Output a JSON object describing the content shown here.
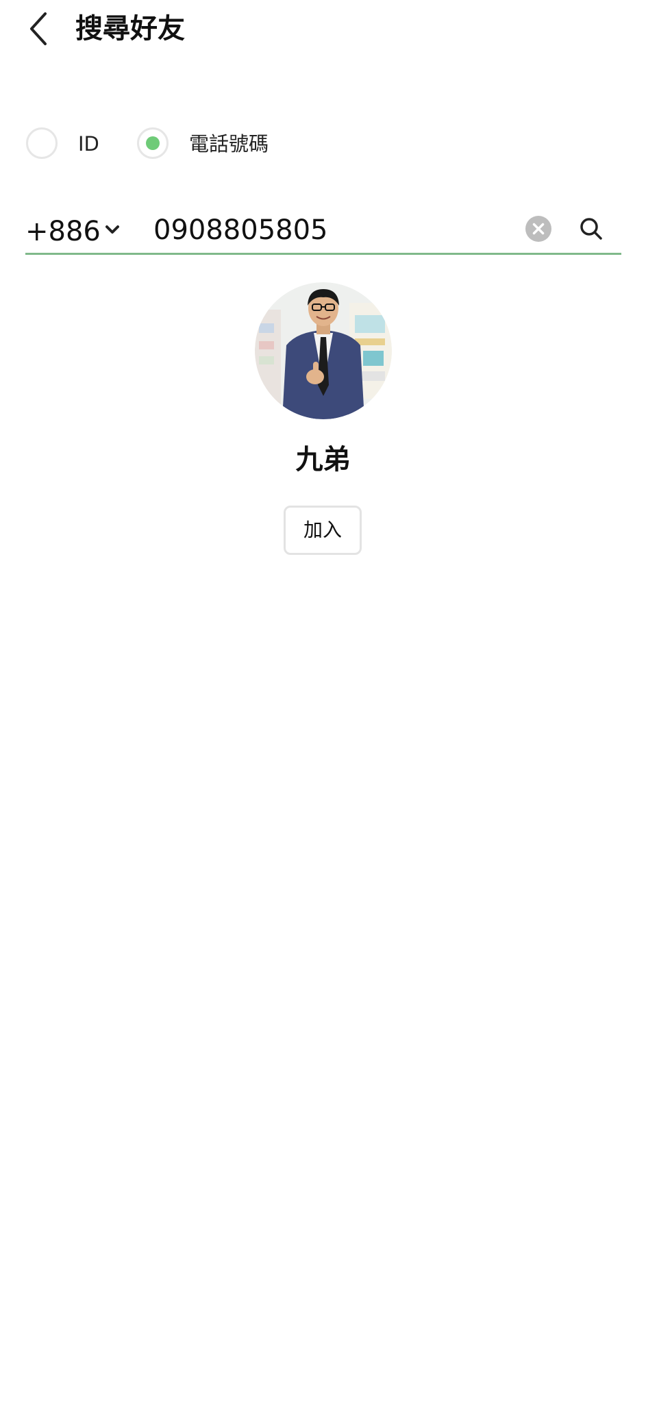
{
  "header": {
    "title": "搜尋好友",
    "back_icon": "chevron-left-icon"
  },
  "search_type": {
    "options": [
      {
        "label": "ID",
        "selected": false
      },
      {
        "label": "電話號碼",
        "selected": true
      }
    ],
    "accent_color": "#6fcb78"
  },
  "search": {
    "country_code": "+886",
    "phone_number": "0908805805",
    "clear_icon": "clear-circle-icon",
    "search_icon": "search-icon",
    "underline_color": "#7fb98a"
  },
  "result": {
    "name": "九弟",
    "avatar_icon": "user-photo",
    "add_label": "加入"
  }
}
